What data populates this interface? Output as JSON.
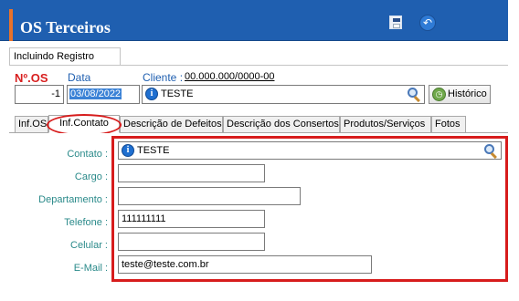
{
  "window": {
    "title": "OS Terceiros",
    "subtab": "Incluindo Registro",
    "colors": {
      "header": "#1f5fb0",
      "accent": "#e8722a",
      "label_blue": "#1f5fb0",
      "label_red": "#d81f1f",
      "field_label": "#2a8a8a",
      "highlight": "#d71c1c"
    }
  },
  "toolbar": {
    "save_icon": "floppy-save-icon",
    "back_icon": "undo-icon",
    "back_glyph": "↶"
  },
  "header_fields": {
    "nos_label": "Nº.OS",
    "nos_value": "-1",
    "data_label": "Data",
    "data_value": "03/08/2022",
    "cliente_label": "Cliente :",
    "cliente_code": "00.000.000/0000-00",
    "cliente_value": "TESTE",
    "historico_label": "Histórico"
  },
  "tabs": [
    "Inf.OS",
    "Inf.Contato",
    "Descrição de Defeitos",
    "Descrição dos Consertos",
    "Produtos/Serviços",
    "Fotos"
  ],
  "active_tab": "Inf.Contato",
  "contact_form": {
    "contato_label": "Contato :",
    "contato_value": "TESTE",
    "cargo_label": "Cargo :",
    "cargo_value": "",
    "departamento_label": "Departamento :",
    "departamento_value": "",
    "telefone_label": "Telefone :",
    "telefone_value": "111111111",
    "celular_label": "Celular :",
    "celular_value": "",
    "email_label": "E-Mail :",
    "email_value": "teste@teste.com.br"
  }
}
